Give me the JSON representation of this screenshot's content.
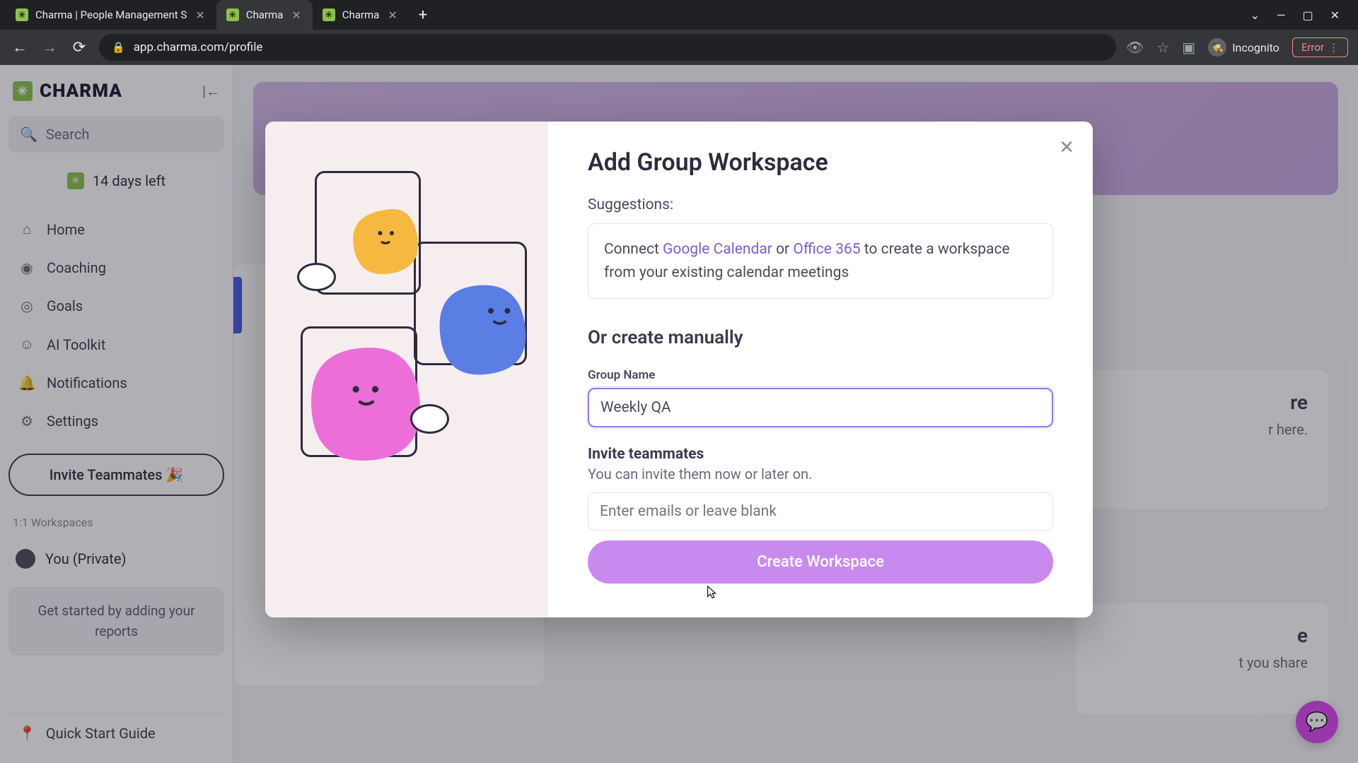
{
  "browser": {
    "tabs": [
      {
        "title": "Charma | People Management S",
        "active": false
      },
      {
        "title": "Charma",
        "active": true
      },
      {
        "title": "Charma",
        "active": false
      }
    ],
    "url": "app.charma.com/profile",
    "incognito_label": "Incognito",
    "error_label": "Error"
  },
  "sidebar": {
    "brand": "CHARMA",
    "search_placeholder": "Search",
    "trial_text": "14 days left",
    "nav": [
      {
        "icon": "⌂",
        "label": "Home"
      },
      {
        "icon": "◉",
        "label": "Coaching"
      },
      {
        "icon": "◎",
        "label": "Goals"
      },
      {
        "icon": "☺",
        "label": "AI Toolkit"
      },
      {
        "icon": "🔔",
        "label": "Notifications"
      },
      {
        "icon": "⚙",
        "label": "Settings"
      }
    ],
    "invite_label": "Invite Teammates 🎉",
    "section_label": "1:1 Workspaces",
    "workspace_item": "You (Private)",
    "hint_text": "Get started by adding your reports",
    "quick_start": "Quick Start Guide"
  },
  "modal": {
    "title": "Add Group Workspace",
    "suggestions_label": "Suggestions:",
    "suggest_prefix": "Connect ",
    "suggest_link1": "Google Calendar",
    "suggest_mid": " or ",
    "suggest_link2": "Office 365",
    "suggest_suffix": " to create a workspace from your existing calendar meetings",
    "manual_title": "Or create manually",
    "group_name_label": "Group Name",
    "group_name_value": "Weekly QA",
    "invite_title": "Invite teammates",
    "invite_sub": "You can invite them now or later on.",
    "email_placeholder": "Enter emails or leave blank",
    "create_label": "Create Workspace"
  },
  "bg": {
    "card1_a": "re",
    "card1_b": "r here.",
    "card2_a": "e",
    "card2_b": "t you share"
  }
}
